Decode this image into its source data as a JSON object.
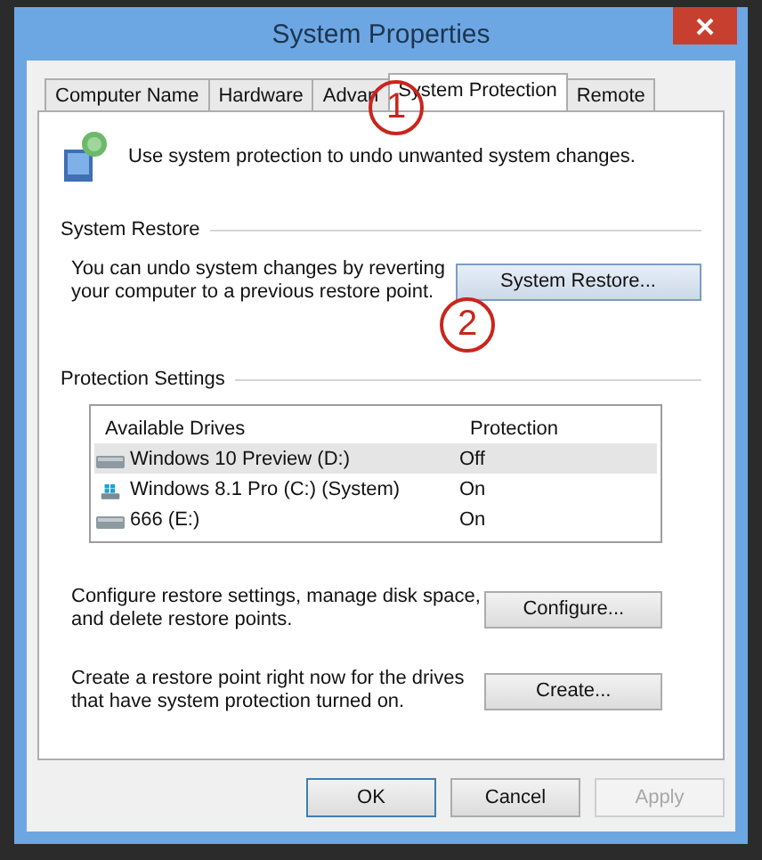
{
  "window": {
    "title": "System Properties"
  },
  "tabs": [
    {
      "label": "Computer Name",
      "selected": false
    },
    {
      "label": "Hardware",
      "selected": false
    },
    {
      "label": "Advan",
      "selected": false
    },
    {
      "label": "System Protection",
      "selected": true
    },
    {
      "label": "Remote",
      "selected": false
    }
  ],
  "intro": "Use system protection to undo unwanted system changes.",
  "system_restore": {
    "heading": "System Restore",
    "description": "You can undo system changes by reverting your computer to a previous restore point.",
    "button": "System Restore..."
  },
  "protection_settings": {
    "heading": "Protection Settings",
    "columns": [
      "Available Drives",
      "Protection"
    ],
    "drives": [
      {
        "name": "Windows 10 Preview (D:)",
        "protection": "Off",
        "kind": "drive",
        "selected": true
      },
      {
        "name": "Windows 8.1 Pro (C:) (System)",
        "protection": "On",
        "kind": "system",
        "selected": false
      },
      {
        "name": "666 (E:)",
        "protection": "On",
        "kind": "drive",
        "selected": false
      }
    ],
    "configure": {
      "description": "Configure restore settings, manage disk space, and delete restore points.",
      "button": "Configure..."
    },
    "create": {
      "description": "Create a restore point right now for the drives that have system protection turned on.",
      "button": "Create..."
    }
  },
  "buttons": [
    {
      "label": "OK",
      "default": true,
      "disabled": false
    },
    {
      "label": "Cancel",
      "default": false,
      "disabled": false
    },
    {
      "label": "Apply",
      "default": false,
      "disabled": true
    }
  ],
  "markers": [
    {
      "number": "1"
    },
    {
      "number": "2"
    }
  ]
}
